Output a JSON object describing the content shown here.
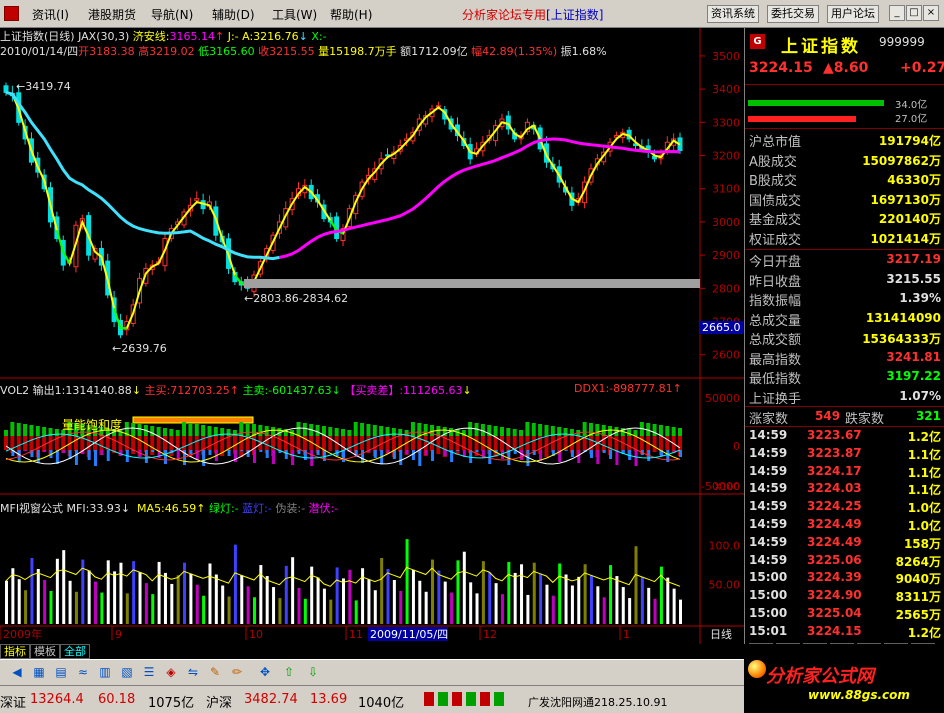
{
  "menu": {
    "items": [
      "资讯(I)",
      "港股期货",
      "导航(N)",
      "辅助(D)",
      "工具(W)",
      "帮助(H)"
    ],
    "title_main": "分析家论坛专用",
    "title_bracket": "[上证指数]",
    "right_buttons": [
      "资讯系统",
      "委托交易",
      "用户论坛"
    ],
    "window_buttons": [
      "_",
      "□",
      "×"
    ]
  },
  "chart_header": {
    "line1_name": "上证指数(日线)",
    "line1_jax": "JAX(30,3)",
    "line1_lbl_jax": "济安线:",
    "line1_val_jax": "3165.14",
    "line1_j": "J:-",
    "line1_a": "A:3216.76",
    "line1_x": "X:-",
    "line2_date": "2010/01/14/四",
    "line2_open": "开3183.38",
    "line2_high": "高3219.02",
    "line2_low": "低3165.60",
    "line2_close": "收3215.55",
    "line2_vol": "量15198.7万手",
    "line2_amt": "额1712.09亿",
    "line2_chg": "幅42.89(1.35%)",
    "line2_amp": "振1.68%"
  },
  "price_axis": [
    "3500",
    "3400",
    "3300",
    "3200",
    "3100",
    "3000",
    "2900",
    "2800",
    "2700",
    "2600"
  ],
  "price_axis_current": "2665.0",
  "annotations": {
    "high_label": "3419.74",
    "low_label": "2639.76",
    "range_label": "2803.86-2834.62",
    "vol_tag": "量能饱和度"
  },
  "vol_header": {
    "name": "VOL2 输出1:1314140.88",
    "buy": "主买:712703.25",
    "sell": "主卖:-601437.63",
    "diff_lbl": "【买卖差】",
    "diff_val": ":111265.63",
    "ddx": "DDX1:-898777.81"
  },
  "vol_axis": [
    "50000",
    "0",
    "-50000"
  ],
  "vol_axis_mult": "X100",
  "mfi_header": {
    "name": "MFI视窗公式 MFI:33.93",
    "ma5": "MA5:46.59",
    "green": "绿灯:-",
    "blue": "蓝灯:-",
    "fake": "伪装:-",
    "hidden": "潜伏:-"
  },
  "mfi_axis": [
    "100.0",
    "50.00"
  ],
  "date_axis": {
    "labels": [
      "2009年",
      "9",
      "10",
      "11",
      "12",
      "1"
    ],
    "current": "2009/11/05/四",
    "period": "日线"
  },
  "quote": {
    "badge": "G",
    "name": "上证指数",
    "code": "999999",
    "price": "3224.15",
    "change": "▲8.60",
    "pct": "+0.27",
    "bar1_pct": "34.0亿",
    "bar2_pct": "27.0亿",
    "rows": [
      {
        "k": "沪总市值",
        "v": "191794亿"
      },
      {
        "k": "A股成交",
        "v": "15097862万"
      },
      {
        "k": "B股成交",
        "v": "46330万"
      },
      {
        "k": "国债成交",
        "v": "1697130万"
      },
      {
        "k": "基金成交",
        "v": "220140万"
      },
      {
        "k": "权证成交",
        "v": "1021414万"
      }
    ],
    "rows2": [
      {
        "k": "今日开盘",
        "v": "3217.19"
      },
      {
        "k": "昨日收盘",
        "v": "3215.55"
      },
      {
        "k": "指数振幅",
        "v": "1.39%"
      },
      {
        "k": "总成交量",
        "v": "131414090"
      },
      {
        "k": "总成交额",
        "v": "15364333万"
      },
      {
        "k": "最高指数",
        "v": "3241.81"
      },
      {
        "k": "最低指数",
        "v": "3197.22"
      },
      {
        "k": "上证换手",
        "v": "1.07%"
      }
    ],
    "up_label": "涨家数",
    "up_val": "549",
    "down_label": "跌家数",
    "down_val": "321",
    "ticks": [
      {
        "t": "14:59",
        "p": "3223.67",
        "v": "1.2亿"
      },
      {
        "t": "14:59",
        "p": "3223.87",
        "v": "1.1亿"
      },
      {
        "t": "14:59",
        "p": "3224.17",
        "v": "1.1亿"
      },
      {
        "t": "14:59",
        "p": "3224.03",
        "v": "1.1亿"
      },
      {
        "t": "14:59",
        "p": "3224.25",
        "v": "1.0亿"
      },
      {
        "t": "14:59",
        "p": "3224.49",
        "v": "1.0亿"
      },
      {
        "t": "14:59",
        "p": "3224.49",
        "v": "158万"
      },
      {
        "t": "14:59",
        "p": "3225.06",
        "v": "8264万"
      },
      {
        "t": "15:00",
        "p": "3224.39",
        "v": "9040万"
      },
      {
        "t": "15:00",
        "p": "3224.90",
        "v": "8311万"
      },
      {
        "t": "15:00",
        "p": "3225.04",
        "v": "2565万"
      },
      {
        "t": "15:01",
        "p": "3224.15",
        "v": "1.2亿"
      }
    ],
    "tabs": [
      "笔",
      "价",
      "细",
      "势",
      "指",
      "值",
      "筹"
    ]
  },
  "tabstrip": [
    "指标",
    "模板",
    "全部"
  ],
  "status": {
    "sz_label": "深证",
    "sz_val": "13264.4",
    "sz_chg": "60.18",
    "sz_amt": "1075亿",
    "hs_label": "沪深",
    "hs_val": "3482.74",
    "hs_chg": "13.69",
    "hs_amt": "1040亿",
    "network": "广发沈阳网通218.25.10.91"
  },
  "logo": {
    "line1": "分析家公式网",
    "line2": "www.88gs.com"
  },
  "colors": {
    "up": "#ff3030",
    "down": "#00e0e0",
    "yellow": "#ffff00",
    "magenta": "#ff00ff",
    "green": "#00ff00",
    "cyan_line": "#40e0ff"
  },
  "chart_data": [
    {
      "type": "candlestick",
      "title": "上证指数(日线)",
      "ylim": [
        2560,
        3560
      ],
      "x_start": "2009-07",
      "x_end": "2010-01-14",
      "annotated_high": 3419.74,
      "annotated_low": 2639.76,
      "closes": [
        3390,
        3380,
        3300,
        3250,
        3180,
        3150,
        3100,
        3000,
        2950,
        2870,
        2880,
        2990,
        3010,
        2900,
        2920,
        2870,
        2780,
        2700,
        2660,
        2700,
        2750,
        2830,
        2860,
        2870,
        2880,
        2950,
        2980,
        3000,
        3030,
        3050,
        3070,
        3040,
        3060,
        2960,
        2940,
        2860,
        2820,
        2810,
        2800,
        2840,
        2880,
        2920,
        2960,
        3000,
        3040,
        3070,
        3100,
        3110,
        3070,
        3060,
        3010,
        3000,
        2950,
        2980,
        3040,
        3080,
        3120,
        3140,
        3160,
        3190,
        3200,
        3210,
        3230,
        3250,
        3270,
        3310,
        3320,
        3340,
        3350,
        3310,
        3280,
        3260,
        3230,
        3190,
        3220,
        3240,
        3260,
        3290,
        3310,
        3280,
        3250,
        3260,
        3300,
        3280,
        3220,
        3180,
        3160,
        3120,
        3090,
        3050,
        3070,
        3120,
        3160,
        3190,
        3210,
        3240,
        3260,
        3270,
        3250,
        3230,
        3220,
        3210,
        3190,
        3200,
        3240,
        3250,
        3215
      ]
    }
  ]
}
